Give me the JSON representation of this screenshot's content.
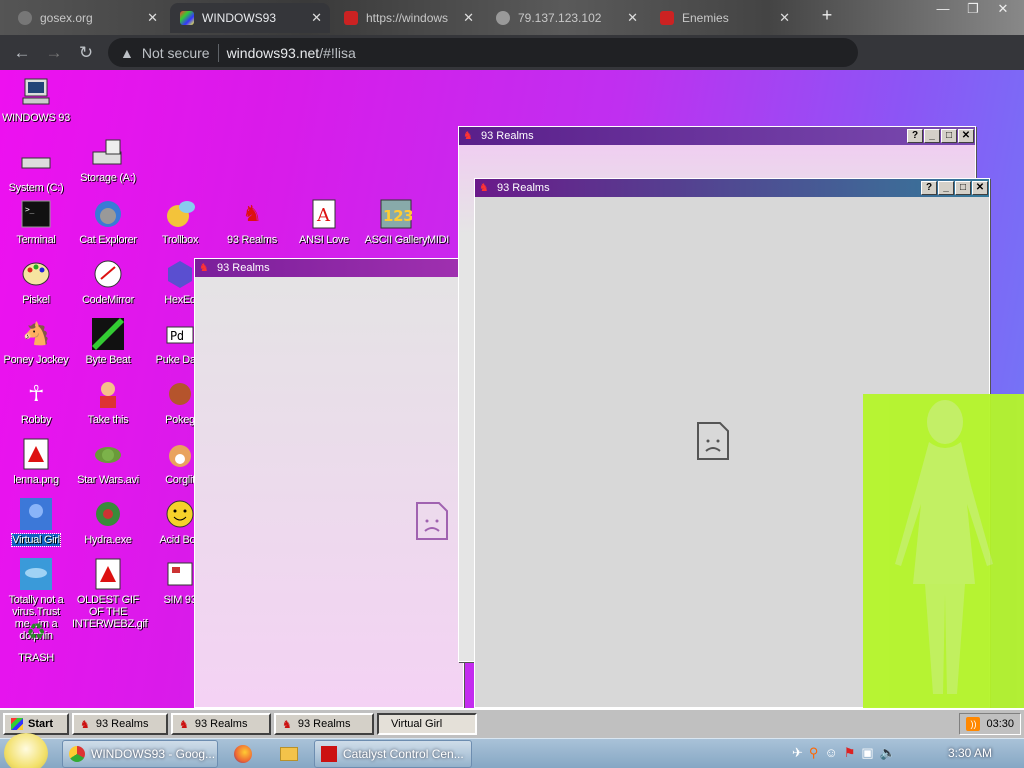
{
  "browser": {
    "tabs": [
      {
        "label": "gosex.org",
        "active": false
      },
      {
        "label": "WINDOWS93",
        "active": true
      },
      {
        "label": "https://windows",
        "active": false
      },
      {
        "label": "79.137.123.102",
        "active": false
      },
      {
        "label": "Enemies",
        "active": false
      }
    ],
    "security_label": "Not secure",
    "url_host": "windows93.net",
    "url_path": "/#!lisa"
  },
  "desktop": {
    "icons": [
      {
        "label": "WINDOWS 93",
        "icon": "computer-icon"
      },
      {
        "label": "System (C:)",
        "icon": "drive-icon"
      },
      {
        "label": "Storage (A:)",
        "icon": "floppy-drive-icon"
      },
      {
        "label": "Terminal",
        "icon": "terminal-icon"
      },
      {
        "label": "Cat Explorer",
        "icon": "cat-explorer-icon"
      },
      {
        "label": "Trollbox",
        "icon": "trollbox-icon"
      },
      {
        "label": "93 Realms",
        "icon": "realms-icon"
      },
      {
        "label": "ANSI Love",
        "icon": "ansi-icon"
      },
      {
        "label": "ASCII Gallery",
        "icon": "ascii-icon"
      },
      {
        "label": "MIDI",
        "icon": "midi-icon"
      },
      {
        "label": "Piskel",
        "icon": "palette-icon"
      },
      {
        "label": "CodeMirror",
        "icon": "codemirror-icon"
      },
      {
        "label": "HexEd",
        "icon": "hexed-icon"
      },
      {
        "label": "Poney Jockey",
        "icon": "pony-icon"
      },
      {
        "label": "Byte Beat",
        "icon": "bytebeat-icon"
      },
      {
        "label": "Puke Data",
        "icon": "pd-icon"
      },
      {
        "label": "Robby",
        "icon": "robot-icon"
      },
      {
        "label": "Take this",
        "icon": "take-this-icon"
      },
      {
        "label": "Pokeg",
        "icon": "pokeg-icon"
      },
      {
        "label": "lenna.png",
        "icon": "image-file-icon"
      },
      {
        "label": "Star Wars.avi",
        "icon": "yoda-icon"
      },
      {
        "label": "Corglit",
        "icon": "corgi-icon"
      },
      {
        "label": "Virtual Girl",
        "icon": "virtual-girl-icon"
      },
      {
        "label": "Hydra.exe",
        "icon": "hydra-icon"
      },
      {
        "label": "Acid Box",
        "icon": "smiley-icon"
      },
      {
        "label": "Totally not a virus.Trust me...im a dolphin",
        "icon": "dolphin-icon"
      },
      {
        "label": "OLDEST GIF OF THE INTERWEBZ.gif",
        "icon": "gif-file-icon"
      },
      {
        "label": "SIM 93",
        "icon": "sim-icon"
      },
      {
        "label": "TRASH",
        "icon": "trash-icon"
      }
    ]
  },
  "windows": [
    {
      "title": "93 Realms"
    },
    {
      "title": "93 Realms"
    },
    {
      "title": "93 Realms"
    }
  ],
  "window_buttons": {
    "help": "?",
    "minimize": "_",
    "maximize": "□",
    "close": "✕"
  },
  "taskbar93": {
    "start_label": "Start",
    "buttons": [
      "93 Realms",
      "93 Realms",
      "93 Realms",
      "Virtual Girl"
    ],
    "clock": "03:30"
  },
  "taskbar7": {
    "buttons": [
      "WINDOWS93 - Goog...",
      "Catalyst Control Cen..."
    ],
    "clock": "3:30 AM"
  }
}
